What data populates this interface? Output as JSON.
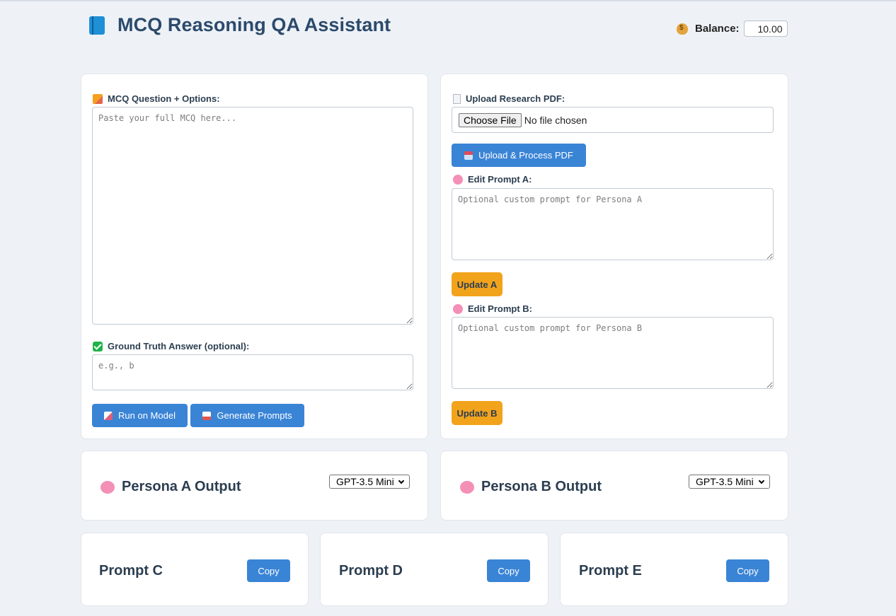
{
  "header": {
    "title": "MCQ Reasoning QA Assistant",
    "balance_label": "Balance:",
    "balance_value": "10.00"
  },
  "left": {
    "mcq_label": "MCQ Question + Options:",
    "mcq_placeholder": "Paste your full MCQ here...",
    "truth_label": "Ground Truth Answer (optional):",
    "truth_placeholder": "e.g., b",
    "run_button": "Run on Model",
    "generate_button": "Generate Prompts"
  },
  "right": {
    "upload_label": "Upload Research PDF:",
    "choose_file": "Choose File",
    "no_file": "No file chosen",
    "upload_button": "Upload & Process PDF",
    "prompt_a_label": "Edit Prompt A:",
    "prompt_a_placeholder": "Optional custom prompt for Persona A",
    "update_a": "Update A",
    "prompt_b_label": "Edit Prompt B:",
    "prompt_b_placeholder": "Optional custom prompt for Persona B",
    "update_b": "Update B"
  },
  "outputs": {
    "persona_a": {
      "title": "Persona A Output",
      "model": "GPT-3.5 Mini"
    },
    "persona_b": {
      "title": "Persona B Output",
      "model": "GPT-3.5 Mini"
    }
  },
  "prompts": [
    {
      "title": "Prompt C",
      "copy": "Copy"
    },
    {
      "title": "Prompt D",
      "copy": "Copy"
    },
    {
      "title": "Prompt E",
      "copy": "Copy"
    }
  ]
}
